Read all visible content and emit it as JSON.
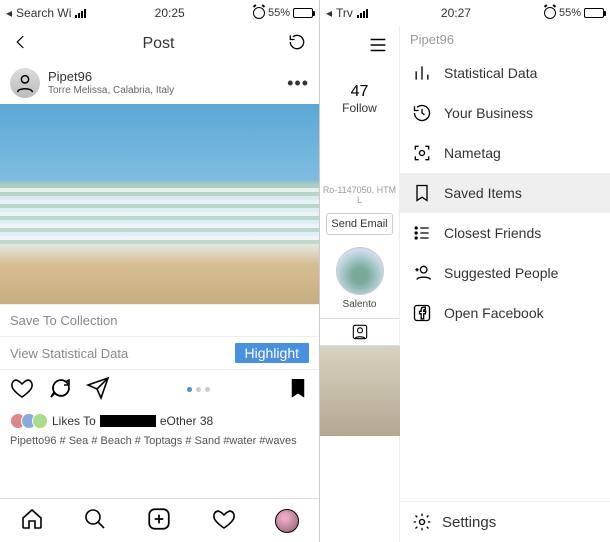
{
  "left": {
    "status": {
      "carrier": "Search Wi",
      "time": "20:25",
      "battery_pct": "55%"
    },
    "header": {
      "title": "Post"
    },
    "post": {
      "username": "Pipet96",
      "location": "Torre Melissa, Calabria, Italy",
      "save_to_collection": "Save To Collection",
      "view_stats": "View Statistical Data",
      "highlight": "Highlight",
      "likes_prefix": "Likes To",
      "likes_suffix": "eOther 38",
      "caption": "Pipetto96 # Sea # Beach # Toptags # Sand #water #waves"
    }
  },
  "right": {
    "status": {
      "carrier": "Trv",
      "time": "20:27",
      "battery_pct": "55%"
    },
    "brand": "Pipet96",
    "profile": {
      "follow_count": "47",
      "follow_label": "Follow",
      "ro_text": "Ro-1147050. HTML",
      "send_email": "Send Email",
      "story_label": "Salento"
    },
    "menu": {
      "stats": "Statistical Data",
      "business": "Your Business",
      "nametag": "Nametag",
      "saved": "Saved Items",
      "friends": "Closest Friends",
      "suggested": "Suggested People",
      "facebook": "Open Facebook"
    },
    "footer": {
      "settings": "Settings"
    }
  }
}
